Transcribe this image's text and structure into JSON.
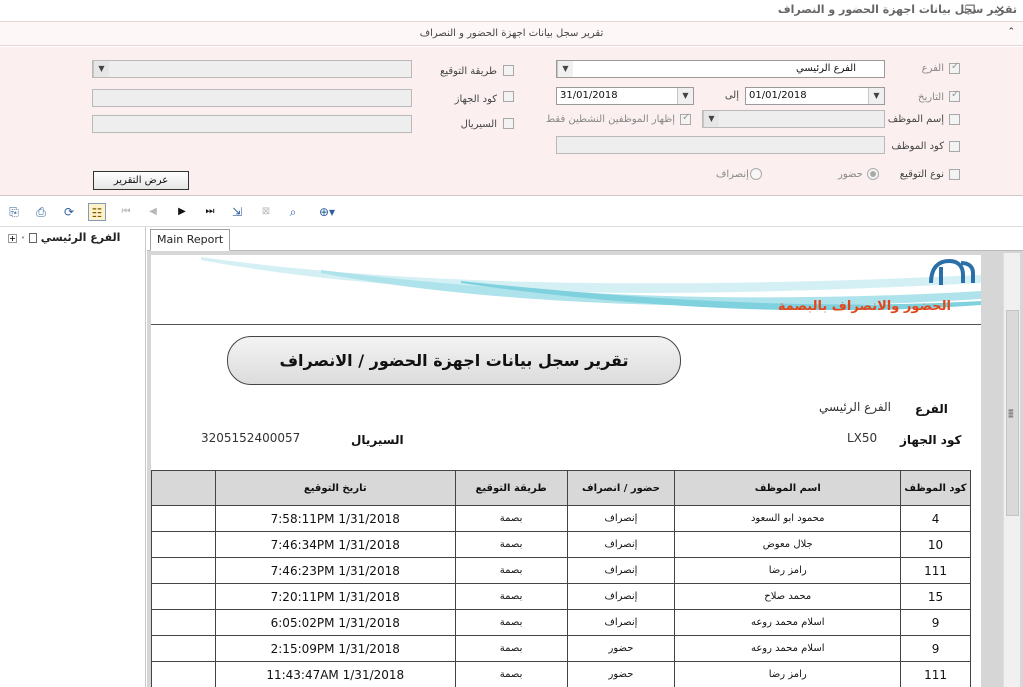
{
  "window": {
    "title": "تقرير سجل بيانات اجهزة الحضور و النصراف",
    "restore_icon": "restore-icon",
    "close_icon": "close-icon"
  },
  "section_header": {
    "title": "تقرير سجل بيانات اجهزة الحضور و النصراف",
    "collapse_icon": "chevron-up-icon"
  },
  "filters": {
    "branch": {
      "label": "الفرع",
      "value": "الفرع الرئيسي"
    },
    "date": {
      "label": "التاريخ",
      "from": "01/01/2018",
      "to_label": "إلى",
      "to": "31/01/2018"
    },
    "employee_name": {
      "label": "إسم الموظف",
      "value": ""
    },
    "show_active_only": {
      "label": "إظهار الموظفين النشطين فقط"
    },
    "employee_code": {
      "label": "كود الموظف",
      "value": ""
    },
    "sign_type": {
      "label": "نوع التوقيع",
      "option_in": "حضور",
      "option_out": "إنصراف"
    },
    "sign_method": {
      "label": "طريقة التوقيع",
      "value": ""
    },
    "device_code": {
      "label": "كود الجهاز",
      "value": ""
    },
    "serial": {
      "label": "السيريال",
      "value": ""
    },
    "show_report_button": "عرض التقرير"
  },
  "toolbar": {
    "icons": [
      "export-icon",
      "print-icon",
      "refresh-icon",
      "tree-toggle-icon",
      "first-page-icon",
      "prev-page-icon",
      "next-page-icon",
      "last-page-icon",
      "go-to-page-icon",
      "stop-icon",
      "find-icon",
      "zoom-icon"
    ]
  },
  "tree": {
    "root": "الفرع الرئيسي"
  },
  "tabs": [
    {
      "label": "Main Report"
    }
  ],
  "report": {
    "logo_subtitle": "الحضور والانصراف بالبصمة",
    "title": "تقرير سجل بيانات اجهزة الحضور / الانصراف",
    "branch_label": "الفرع",
    "branch_value": "الفرع الرئيسي",
    "device_code_label": "كود الجهاز",
    "device_code_value": "LX50",
    "serial_label": "السيريال",
    "serial_value": "3205152400057",
    "columns": [
      "كود الموظف",
      "اسم الموظف",
      "حضور / انصراف",
      "طريقة التوقيع",
      "تاريخ التوقيع"
    ],
    "rows": [
      {
        "code": "4",
        "name": "محمود ابو السعود",
        "type": "إنصراف",
        "method": "بصمة",
        "date": "1/31/2018   7:58:11PM"
      },
      {
        "code": "10",
        "name": "جلال معوض",
        "type": "إنصراف",
        "method": "بصمة",
        "date": "1/31/2018   7:46:34PM"
      },
      {
        "code": "111",
        "name": "رامز رضا",
        "type": "إنصراف",
        "method": "بصمة",
        "date": "1/31/2018   7:46:23PM"
      },
      {
        "code": "15",
        "name": "محمد صلاح",
        "type": "إنصراف",
        "method": "بصمة",
        "date": "1/31/2018   7:20:11PM"
      },
      {
        "code": "9",
        "name": "اسلام محمد روعه",
        "type": "إنصراف",
        "method": "بصمة",
        "date": "1/31/2018   6:05:02PM"
      },
      {
        "code": "9",
        "name": "اسلام محمد روعه",
        "type": "حضور",
        "method": "بصمة",
        "date": "1/31/2018   2:15:09PM"
      },
      {
        "code": "111",
        "name": "رامز رضا",
        "type": "حضور",
        "method": "بصمة",
        "date": "1/31/2018  11:43:47AM"
      }
    ]
  }
}
